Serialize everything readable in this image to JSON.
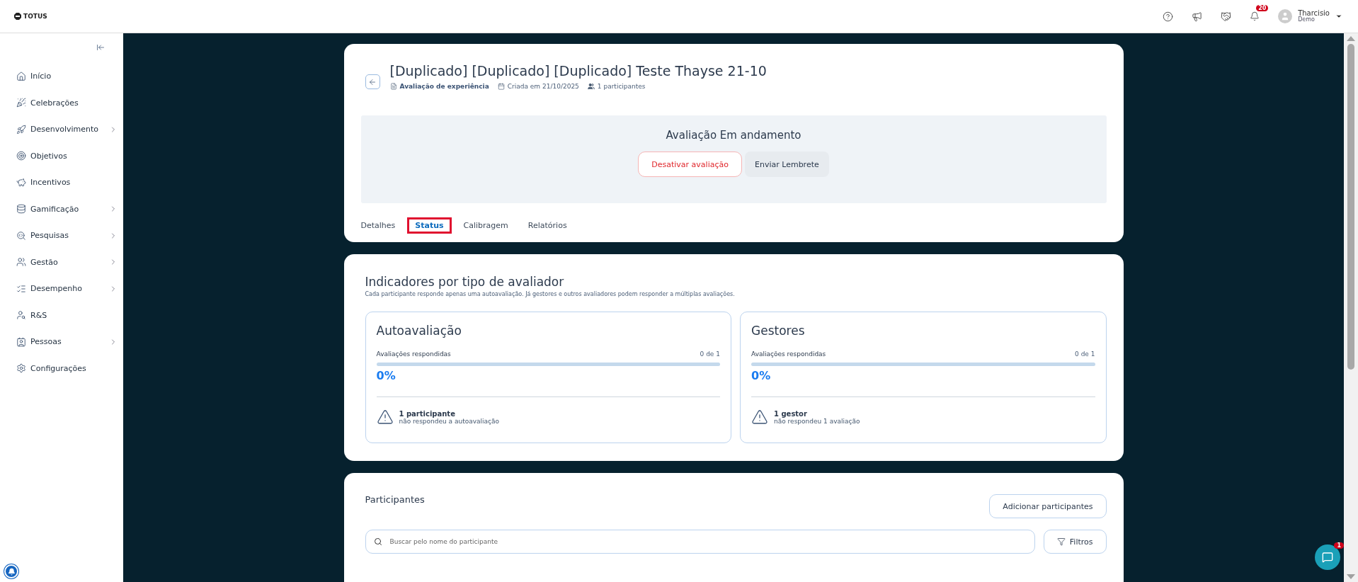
{
  "header": {
    "brand": "TOTUS",
    "notifications_badge": "20",
    "user": {
      "name": "Tharcisio",
      "role": "Demo"
    }
  },
  "sidebar": {
    "items": [
      {
        "label": "Início",
        "has_children": false
      },
      {
        "label": "Celebrações",
        "has_children": false
      },
      {
        "label": "Desenvolvimento",
        "has_children": true
      },
      {
        "label": "Objetivos",
        "has_children": false
      },
      {
        "label": "Incentivos",
        "has_children": false
      },
      {
        "label": "Gamificação",
        "has_children": true
      },
      {
        "label": "Pesquisas",
        "has_children": true
      },
      {
        "label": "Gestão",
        "has_children": true
      },
      {
        "label": "Desempenho",
        "has_children": true
      },
      {
        "label": "R&S",
        "has_children": false
      },
      {
        "label": "Pessoas",
        "has_children": true
      },
      {
        "label": "Configurações",
        "has_children": false
      }
    ]
  },
  "evaluation": {
    "title": "[Duplicado] [Duplicado] [Duplicado] Teste Thayse 21-10",
    "type": "Avaliação de experiência",
    "created": "Criada em 21/10/2025",
    "participants": "1 participantes",
    "status_text": "Avaliação Em andamento",
    "deactivate_button": "Desativar avaliação",
    "reminder_button": "Enviar Lembrete",
    "tabs": [
      {
        "label": "Detalhes",
        "selected": false
      },
      {
        "label": "Status",
        "selected": true
      },
      {
        "label": "Calibragem",
        "selected": false
      },
      {
        "label": "Relatórios",
        "selected": false
      }
    ]
  },
  "indicators": {
    "title": "Indicadores por tipo de avaliador",
    "subtitle": "Cada participante responde apenas uma autoavaliação. Já gestores e outros avaliadores podem responder a múltiplas avaliações.",
    "cards": [
      {
        "title": "Autoavaliação",
        "progress_label": "Avaliações respondidas",
        "count": "0 de 1",
        "level": 0,
        "percent": "0%",
        "pending_strong": "1 participante",
        "pending_text": "não respondeu a autoavaliação"
      },
      {
        "title": "Gestores",
        "progress_label": "Avaliações respondidas",
        "count": "0 de 1",
        "level": 0,
        "percent": "0%",
        "pending_strong": "1 gestor",
        "pending_text": "não respondeu 1 avaliação"
      }
    ]
  },
  "participants": {
    "title": "Participantes",
    "add_button": "Adicionar participantes",
    "search": {
      "placeholder": "Buscar pelo nome do participante"
    },
    "filters_button": "Filtros"
  },
  "chat": {
    "badge": "1"
  }
}
